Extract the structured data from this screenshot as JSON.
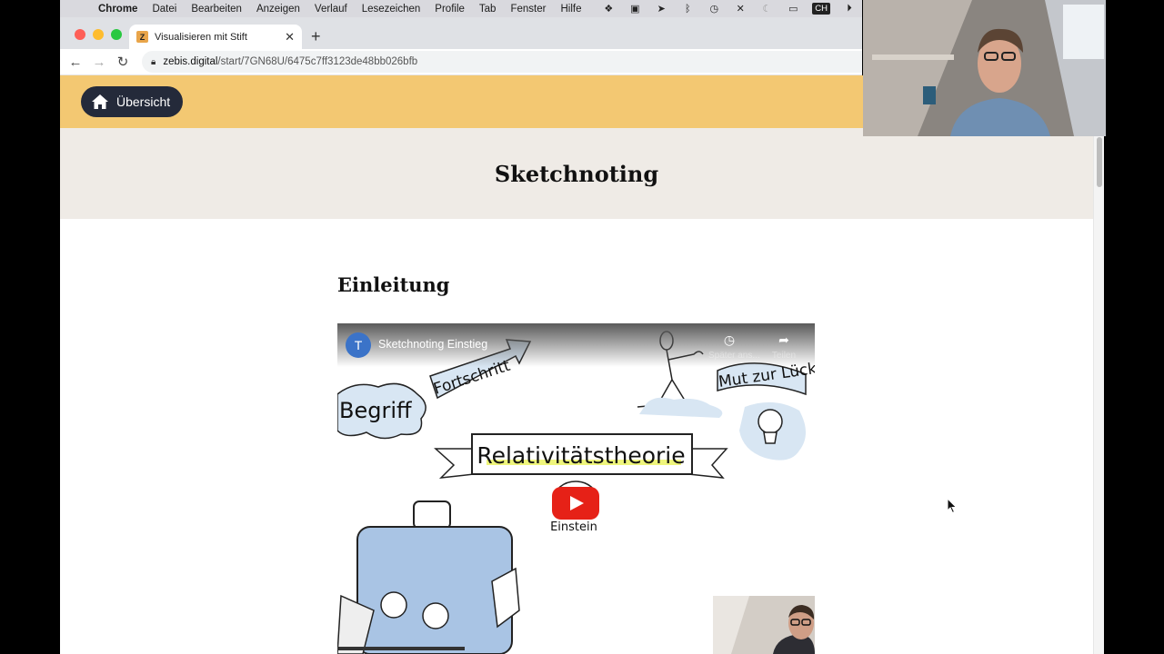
{
  "menubar": {
    "app_name": "Chrome",
    "items": [
      "Datei",
      "Bearbeiten",
      "Anzeigen",
      "Verlauf",
      "Lesezeichen",
      "Profile",
      "Tab",
      "Fenster",
      "Hilfe"
    ],
    "input_source": "CH"
  },
  "browser": {
    "tab_title": "Visualisieren mit Stift",
    "favicon_letter": "Z",
    "url_host": "zebis.digital",
    "url_path": "/start/7GN68U/6475c7ff3123de48bb026bfb"
  },
  "page": {
    "home_label": "Übersicht",
    "title": "Sketchnoting",
    "section_heading": "Einleitung"
  },
  "video": {
    "channel_initial": "T",
    "title": "Sketchnoting Einstieg",
    "watch_later_label": "Später ans...",
    "share_label": "Teilen",
    "sketch_words": {
      "fortschritt": "Fortschritt",
      "begriff": "Begriff",
      "mut": "Mut zur Lücke",
      "relativ": "Relativitätstheorie",
      "einstein": "Einstein"
    }
  },
  "colors": {
    "header_yellow": "#f3c872",
    "title_band": "#efebe6",
    "home_button": "#242a3a",
    "youtube_red": "#e62117"
  }
}
